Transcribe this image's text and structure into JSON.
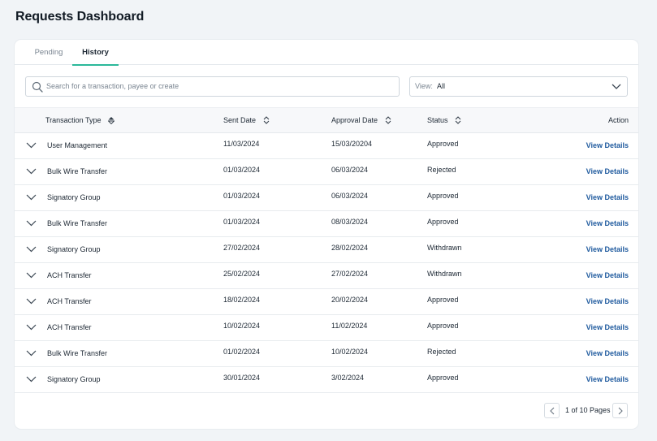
{
  "page": {
    "title": "Requests Dashboard"
  },
  "tabs": [
    {
      "label": "Pending",
      "active": false
    },
    {
      "label": "History",
      "active": true
    }
  ],
  "search": {
    "placeholder": "Search for a transaction, payee or create",
    "icon": "search-icon"
  },
  "view_filter": {
    "label": "View:",
    "value": "All",
    "icon": "chevron-down-icon"
  },
  "table": {
    "headers": {
      "type": "Transaction Type",
      "sent": "Sent Date",
      "approval": "Approval Date",
      "status": "Status",
      "action": "Action"
    },
    "rows": [
      {
        "type": "User Management",
        "sent": "11/03/2024",
        "approval": "15/03/20204",
        "status": "Approved",
        "action": "View Details"
      },
      {
        "type": "Bulk Wire Transfer",
        "sent": "01/03/2024",
        "approval": "06/03/2024",
        "status": "Rejected",
        "action": "View Details"
      },
      {
        "type": "Signatory Group",
        "sent": "01/03/2024",
        "approval": "06/03/2024",
        "status": "Approved",
        "action": "View Details"
      },
      {
        "type": "Bulk Wire Transfer",
        "sent": "01/03/2024",
        "approval": "08/03/2024",
        "status": "Approved",
        "action": "View Details"
      },
      {
        "type": "Signatory Group",
        "sent": "27/02/2024",
        "approval": "28/02/2024",
        "status": "Withdrawn",
        "action": "View Details"
      },
      {
        "type": "ACH Transfer",
        "sent": "25/02/2024",
        "approval": "27/02/2024",
        "status": "Withdrawn",
        "action": "View Details"
      },
      {
        "type": "ACH Transfer",
        "sent": "18/02/2024",
        "approval": "20/02/2024",
        "status": "Approved",
        "action": "View Details"
      },
      {
        "type": "ACH Transfer",
        "sent": "10/02/2024",
        "approval": "11/02/2024",
        "status": "Approved",
        "action": "View Details"
      },
      {
        "type": "Bulk Wire Transfer",
        "sent": "01/02/2024",
        "approval": "10/02/2024",
        "status": "Rejected",
        "action": "View Details"
      },
      {
        "type": "Signatory Group",
        "sent": "30/01/2024",
        "approval": "3/02/2024",
        "status": "Approved",
        "action": "View Details"
      }
    ]
  },
  "pagination": {
    "text": "1 of 10 Pages",
    "prev_icon": "chevron-left-icon",
    "next_icon": "chevron-right-icon"
  },
  "colors": {
    "accent_tab": "#2bb89a",
    "link": "#1f5a9e",
    "background": "#f1f4f7"
  }
}
